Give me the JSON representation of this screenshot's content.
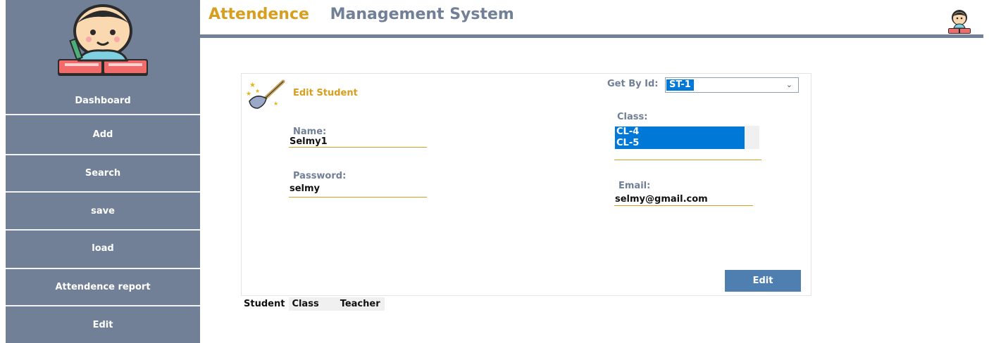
{
  "header": {
    "title_part1": "Attendence",
    "title_part2": "Management System"
  },
  "sidebar": {
    "items": [
      {
        "label": "Dashboard"
      },
      {
        "label": "Add"
      },
      {
        "label": "Search"
      },
      {
        "label": "save"
      },
      {
        "label": "load"
      },
      {
        "label": "Attendence report"
      },
      {
        "label": "Edit"
      }
    ]
  },
  "form": {
    "title": "Edit Student",
    "get_by_id_label": "Get By Id:",
    "get_by_id_value": "ST-1",
    "name_label": "Name:",
    "name_value": "Selmy1",
    "password_label": "Password:",
    "password_value": "selmy",
    "class_label": "Class:",
    "class_items": [
      "CL-4",
      "CL-5"
    ],
    "email_label": "Email:",
    "email_value": "selmy@gmail.com",
    "edit_button": "Edit"
  },
  "tabs": [
    {
      "label": "Student"
    },
    {
      "label": "Class"
    },
    {
      "label": "Teacher"
    }
  ],
  "colors": {
    "accent": "#d89e1e",
    "sidebar": "#718096",
    "selection": "#0078d7",
    "button": "#4f7fb0"
  },
  "icons": {
    "sidebar_avatar": "student-reading-avatar-icon",
    "top_avatar": "student-reading-avatar-icon",
    "edit_student": "magic-broom-icon"
  }
}
